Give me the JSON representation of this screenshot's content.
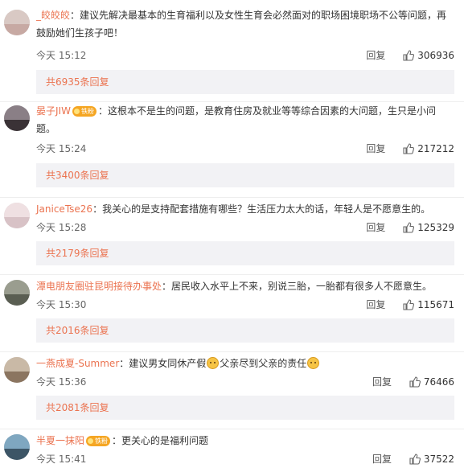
{
  "comments": [
    {
      "user": "_皎皎皎",
      "badge": "",
      "text": "建议先解决最基本的生育福利以及女性生育会必然面对的职场困境职场不公等问题，再鼓励她们生孩子吧！",
      "time": "今天 15:12",
      "reply_label": "回复",
      "likes": "306936",
      "more": "共6935条回复"
    },
    {
      "user": "晏子JIW",
      "badge": "铁粉",
      "text": "这根本不是生的问题，是教育住房及就业等等综合因素的大问题，生只是小问题。",
      "time": "今天 15:24",
      "reply_label": "回复",
      "likes": "217212",
      "more": "共3400条回复"
    },
    {
      "user": "JaniceTse26",
      "badge": "",
      "text": "我关心的是支持配套措施有哪些？生活压力太大的话，年轻人是不愿意生的。",
      "time": "今天 15:28",
      "reply_label": "回复",
      "likes": "125329",
      "more": "共2179条回复"
    },
    {
      "user": "潭电朋友圈驻昆明接待办事处",
      "badge": "",
      "text": "居民收入水平上不来，别说三胎，一胎都有很多人不愿意生。",
      "time": "今天 15:30",
      "reply_label": "回复",
      "likes": "115671",
      "more": "共2016条回复"
    },
    {
      "user": "一燕成夏-Summer",
      "badge": "",
      "text_a": "建议男女同休产假",
      "text_b": "父亲尽到父亲的责任",
      "time": "今天 15:36",
      "reply_label": "回复",
      "likes": "76466",
      "more": "共2081条回复"
    },
    {
      "user": "半夏一抹阳",
      "badge": "铁粉",
      "text": "更关心的是福利问题",
      "time": "今天 15:41",
      "reply_label": "回复",
      "likes": "37522",
      "more": ""
    }
  ],
  "icons": {
    "like": "thumbs-up-icon",
    "emoji": "cat-face-emoji-icon",
    "badge": "fan-badge-icon"
  },
  "colors": {
    "username": "#eb7350",
    "reply_bg": "#f2f2f5",
    "reply_count": "#eb7350"
  }
}
